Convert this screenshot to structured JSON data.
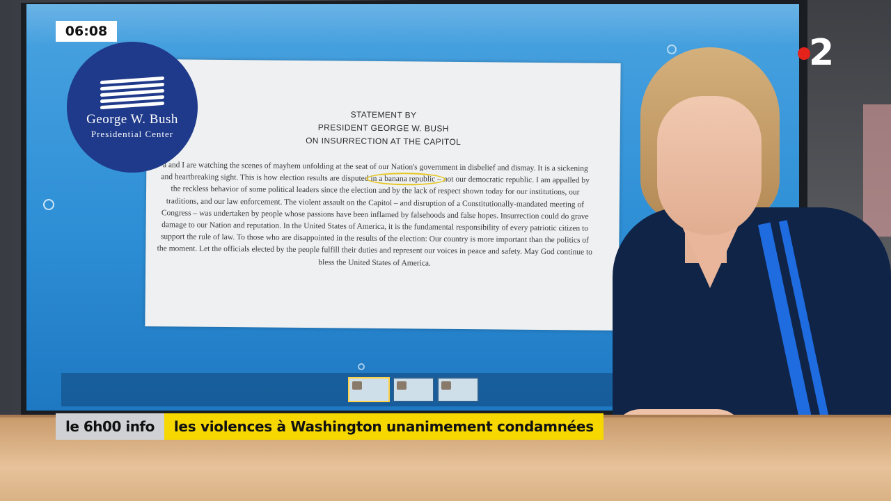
{
  "overlay": {
    "clock": "06:08",
    "channel_number": "2",
    "show_tag": "le 6h00 info",
    "headline": "les violences à Washington unanimement condamnées"
  },
  "logo": {
    "line1": "George W. Bush",
    "line2": "Presidential Center"
  },
  "document": {
    "heading": [
      "STATEMENT BY",
      "PRESIDENT GEORGE W. BUSH",
      "ON INSURRECTION AT THE CAPITOL"
    ],
    "body_before": "a and I are watching the scenes of mayhem unfolding at the seat of our Nation's government in disbelief and dismay. It is a sickening and heartbreaking sight. This is how election results are disputed ",
    "body_highlight": "in a banana republic –",
    "body_after": " not our democratic republic. I am appalled by the reckless behavior of some political leaders since the election and by the lack of respect shown today for our institutions, our traditions, and our law enforcement. The violent assault on the Capitol – and disruption of a Constitutionally-mandated meeting of Congress – was undertaken by people whose passions have been inflamed by falsehoods and false hopes. Insurrection could do grave damage to our Nation and reputation. In the United States of America, it is the fundamental responsibility of every patriotic citizen to support the rule of law. To those who are disappointed in the results of the election: Our country is more important than the politics of the moment. Let the officials elected by the people fulfill their duties and represent our voices in peace and safety. May God continue to bless the United States of America."
  },
  "colors": {
    "channel_red": "#e5231b",
    "headline_yellow": "#f6d800",
    "logo_blue": "#1f3a8a",
    "screen_blue": "#2e8fd6"
  }
}
